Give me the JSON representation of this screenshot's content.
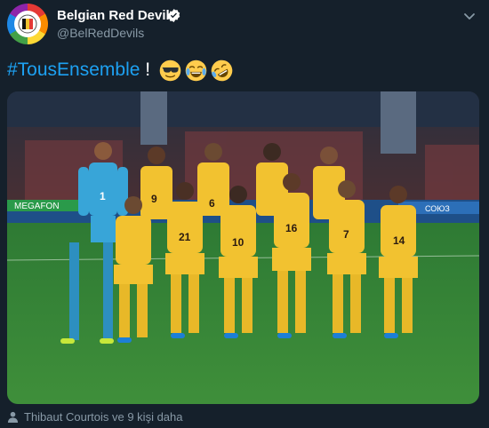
{
  "tweet": {
    "display_name": "Belgian Red Devils",
    "handle": "@BelRedDevils",
    "hashtag": "#TousEnsemble",
    "text_after": " ! ",
    "emojis": [
      "smiling-face-with-sunglasses",
      "face-with-tears-of-joy",
      "rolling-on-the-floor-laughing"
    ],
    "verified": true,
    "tagged_text": "Thibaut Courtois ve 9 kişi daha"
  },
  "photo": {
    "description_icon": "team-photo",
    "banner_left": "MEGAFON",
    "banner_right": "СОЮЗ",
    "back_row_numbers": [
      "1",
      "9",
      "6",
      "",
      "",
      ""
    ],
    "front_row_numbers": [
      "",
      "21",
      "10",
      "16",
      "7",
      "14"
    ],
    "colors": {
      "kit": "#f2c230",
      "keeper": "#38a5d8",
      "pitch": "#2f7d32",
      "crowd": "#3a2a30"
    }
  },
  "colors": {
    "background": "#15202b",
    "accent": "#1da1f2",
    "secondary_text": "#8899a6"
  }
}
